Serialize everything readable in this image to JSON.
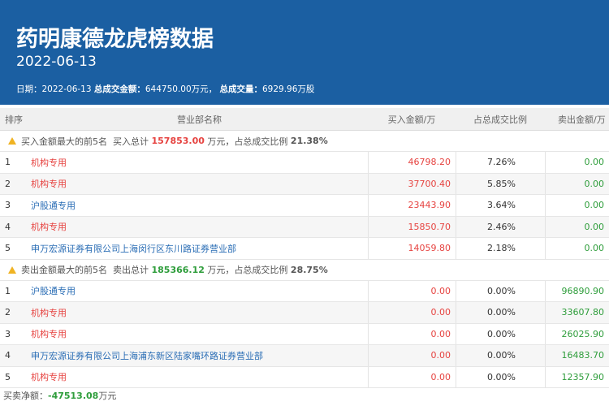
{
  "header": {
    "title": "药明康德龙虎榜数据",
    "date": "2022-06-13",
    "summary_date_label": "日期：",
    "summary_date": "2022-06-13",
    "summary_amount_label": "总成交金额：",
    "summary_amount": "644750.00万元，",
    "summary_volume_label": "总成交量：",
    "summary_volume": "6929.96万股"
  },
  "columns": {
    "rank": "排序",
    "name": "营业部名称",
    "buy": "买入金额/万",
    "pct": "占总成交比例",
    "sell": "卖出金额/万"
  },
  "buy_group": {
    "label": "买入金额最大的前5名",
    "total_label": "买入总计",
    "total": "157853.00",
    "unit": "万元，",
    "ratio_label": "占总成交比例",
    "ratio": "21.38%"
  },
  "buy_rows": [
    {
      "rank": "1",
      "name": "机构专用",
      "buy": "46798.20",
      "pct": "7.26%",
      "sell": "0.00"
    },
    {
      "rank": "2",
      "name": "机构专用",
      "buy": "37700.40",
      "pct": "5.85%",
      "sell": "0.00"
    },
    {
      "rank": "3",
      "name": "沪股通专用",
      "buy": "23443.90",
      "pct": "3.64%",
      "sell": "0.00"
    },
    {
      "rank": "4",
      "name": "机构专用",
      "buy": "15850.70",
      "pct": "2.46%",
      "sell": "0.00"
    },
    {
      "rank": "5",
      "name": "申万宏源证券有限公司上海闵行区东川路证券营业部",
      "buy": "14059.80",
      "pct": "2.18%",
      "sell": "0.00"
    }
  ],
  "sell_group": {
    "label": "卖出金额最大的前5名",
    "total_label": "卖出总计",
    "total": "185366.12",
    "unit": "万元，",
    "ratio_label": "占总成交比例",
    "ratio": "28.75%"
  },
  "sell_rows": [
    {
      "rank": "1",
      "name": "沪股通专用",
      "buy": "0.00",
      "pct": "0.00%",
      "sell": "96890.90"
    },
    {
      "rank": "2",
      "name": "机构专用",
      "buy": "0.00",
      "pct": "0.00%",
      "sell": "33607.80"
    },
    {
      "rank": "3",
      "name": "机构专用",
      "buy": "0.00",
      "pct": "0.00%",
      "sell": "26025.90"
    },
    {
      "rank": "4",
      "name": "申万宏源证券有限公司上海浦东新区陆家嘴环路证券营业部",
      "buy": "0.00",
      "pct": "0.00%",
      "sell": "16483.70"
    },
    {
      "rank": "5",
      "name": "机构专用",
      "buy": "0.00",
      "pct": "0.00%",
      "sell": "12357.90"
    }
  ],
  "footer": {
    "label": "买卖净额：",
    "value": "-47513.08",
    "unit": "万元"
  },
  "colors": {
    "header_bg": "#1b5fa2",
    "buy_red": "#e64340",
    "sell_green": "#2e9d3b",
    "warn_icon": "#f0b323"
  }
}
